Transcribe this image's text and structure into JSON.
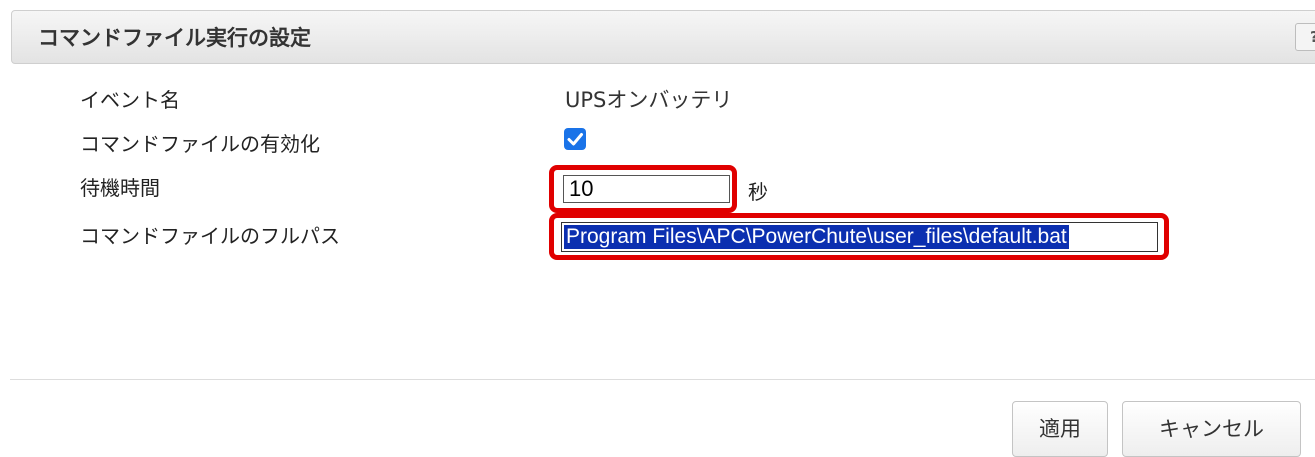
{
  "header": {
    "title": "コマンドファイル実行の設定",
    "help_label": "?"
  },
  "form": {
    "event_name": {
      "label": "イベント名",
      "value": "UPSオンバッテリ"
    },
    "enable_command": {
      "label": "コマンドファイルの有効化",
      "checked": true
    },
    "wait_time": {
      "label": "待機時間",
      "value": "10",
      "unit": "秒"
    },
    "full_path": {
      "label": "コマンドファイルのフルパス",
      "value": "Program Files\\APC\\PowerChute\\user_files\\default.bat"
    }
  },
  "buttons": {
    "apply": "適用",
    "cancel": "キャンセル"
  },
  "colors": {
    "highlight": "#e00000",
    "checkbox": "#1a73e8",
    "selection": "#0b2fb0"
  }
}
